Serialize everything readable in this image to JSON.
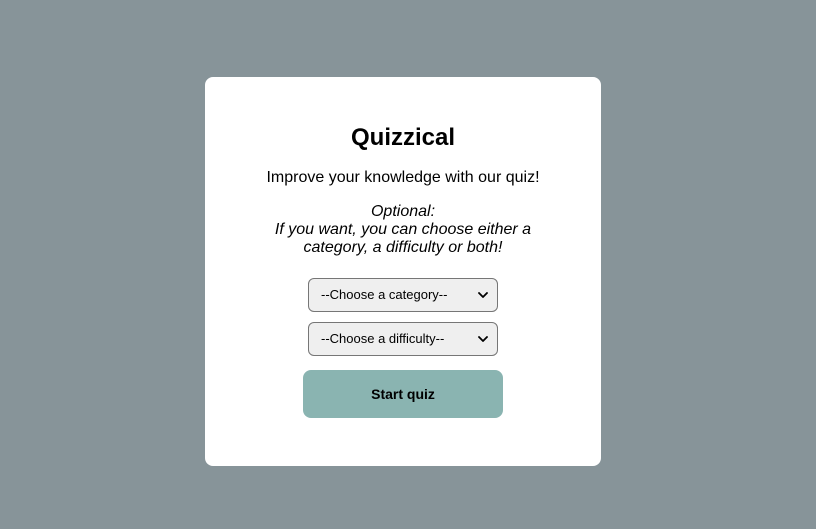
{
  "colors": {
    "background": "#879499",
    "card": "#ffffff",
    "button": "#8ab4b1"
  },
  "card": {
    "title": "Quizzical",
    "subtitle": "Improve your knowledge with our quiz!",
    "optional_label": "Optional:",
    "optional_text": "If you want, you can choose either a category, a difficulty or both!"
  },
  "form": {
    "category_select": {
      "selected": "--Choose a category--",
      "icon": "chevron-down-icon"
    },
    "difficulty_select": {
      "selected": "--Choose a difficulty--",
      "icon": "chevron-down-icon"
    },
    "start_label": "Start quiz"
  }
}
